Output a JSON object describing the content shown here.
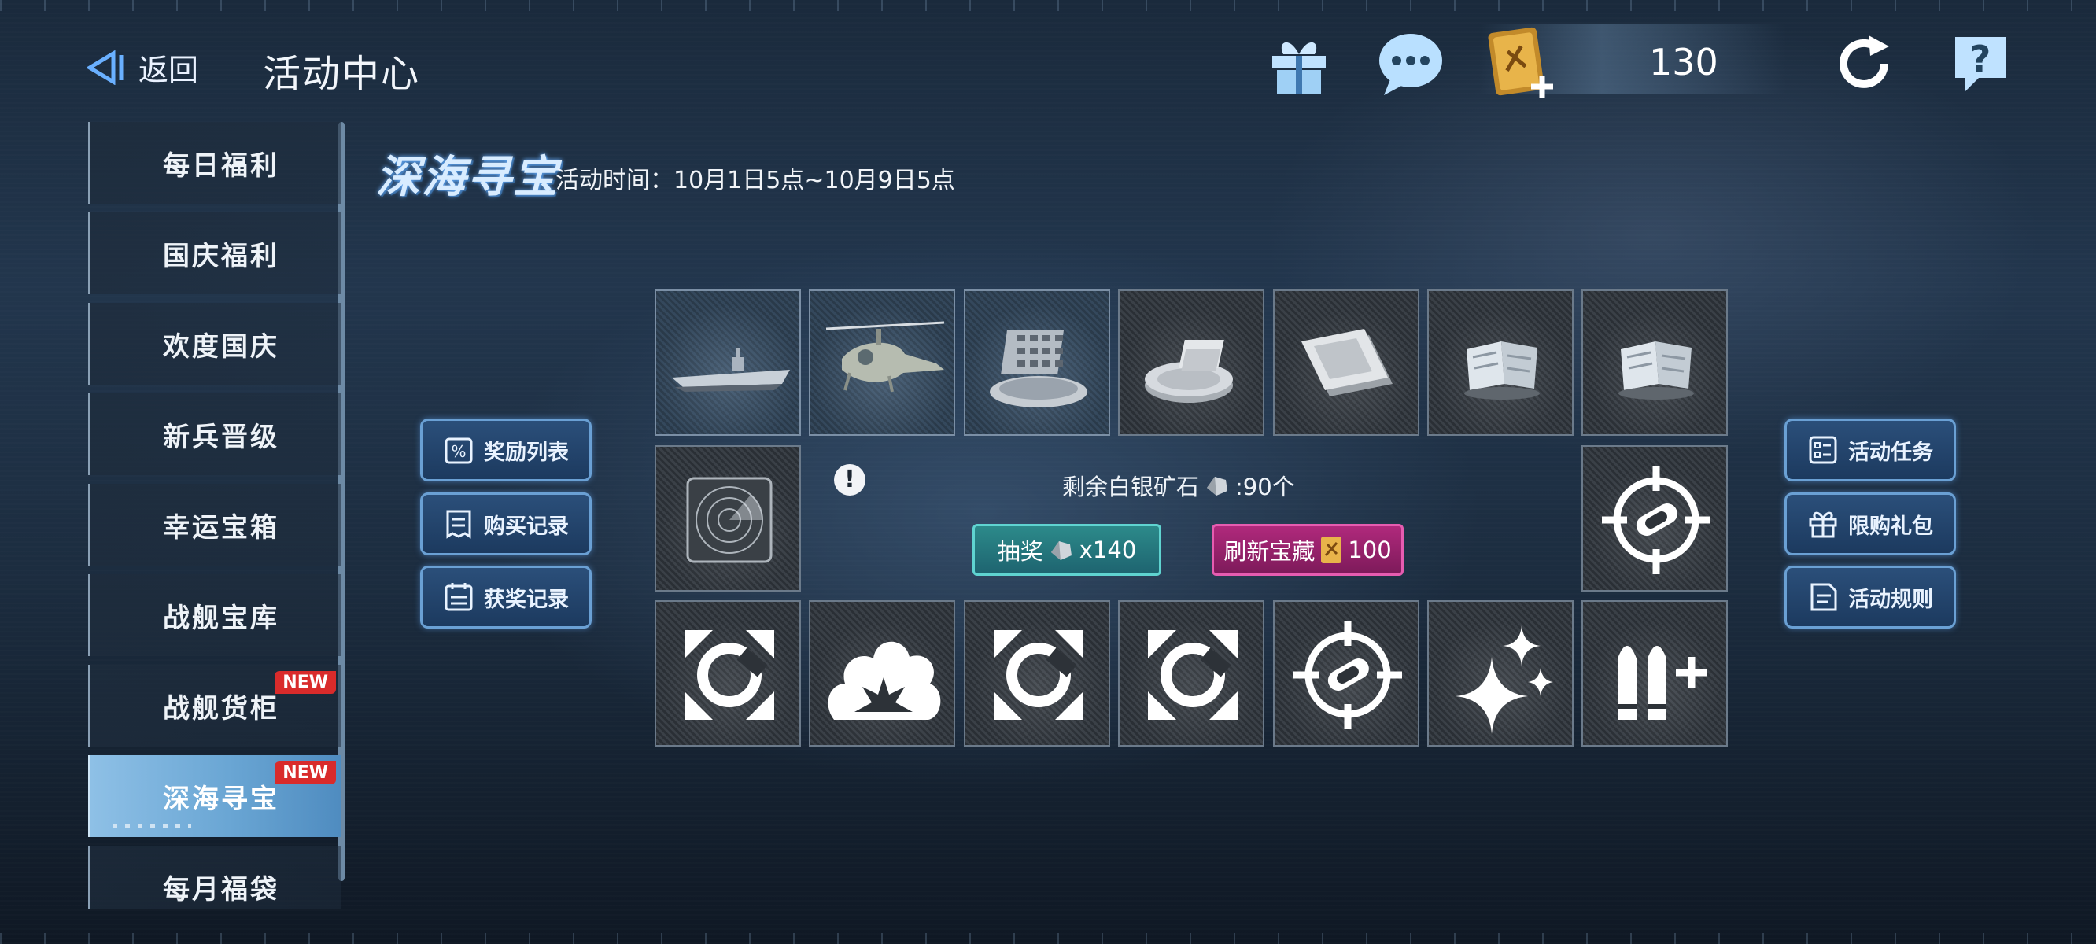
{
  "header": {
    "back_label": "返回",
    "title": "活动中心",
    "currency_value": "130"
  },
  "sidebar": {
    "items": [
      {
        "label": "每日福利",
        "new": false
      },
      {
        "label": "国庆福利",
        "new": false
      },
      {
        "label": "欢度国庆",
        "new": false
      },
      {
        "label": "新兵晋级",
        "new": false
      },
      {
        "label": "幸运宝箱",
        "new": false
      },
      {
        "label": "战舰宝库",
        "new": false
      },
      {
        "label": "战舰货柜",
        "new": true
      },
      {
        "label": "深海寻宝",
        "new": true,
        "active": true
      },
      {
        "label": "每月福袋",
        "new": false
      }
    ],
    "new_badge": "NEW"
  },
  "event": {
    "title": "深海寻宝",
    "time": "活动时间：10月1日5点~10月9日5点"
  },
  "left_buttons": [
    "奖励列表",
    "购买记录",
    "获奖记录"
  ],
  "right_buttons": [
    "活动任务",
    "限购礼包",
    "活动规则"
  ],
  "center": {
    "remain_prefix": "剩余白银矿石",
    "remain_suffix": ":90个",
    "draw_label": "抽奖",
    "draw_cost": "x140",
    "refresh_label": "刷新宝藏",
    "refresh_cost": "100"
  },
  "grid": {
    "top": [
      "aircraft-carrier-icon",
      "attack-helicopter-icon",
      "rocket-launcher-icon",
      "silver-coins-icon",
      "silver-plates-icon",
      "ice-ore-icon",
      "ice-ore-icon"
    ],
    "middle_left": "radar-icon",
    "middle_right": "target-missile-icon",
    "bottom": [
      "repair-wrench-icon",
      "explosion-icon",
      "repair-wrench-icon",
      "repair-wrench-icon",
      "target-missile-icon",
      "sparkle-icon",
      "ammo-plus-icon"
    ]
  },
  "colors": {
    "accent_blue": "#6aa6d4",
    "draw_button": "#2c8a8a",
    "refresh_button": "#b0297c",
    "new_badge": "#d92b2b"
  }
}
